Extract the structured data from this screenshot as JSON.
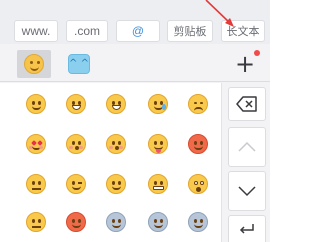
{
  "quick_input": {
    "keys": [
      "www.",
      ".com",
      "@",
      "剪贴板",
      "长文本"
    ]
  },
  "category_bar": {
    "tabs": [
      {
        "icon": "emoji-smile-icon",
        "active": true
      },
      {
        "icon": "kaomoji-face-icon",
        "active": false,
        "glyph": "^ ^"
      }
    ],
    "plus_label": "+",
    "badge_color": "#f24a4a"
  },
  "emoji_grid": {
    "rows": [
      [
        "smile",
        "grin",
        "grin",
        "tear",
        "cry"
      ],
      [
        "heart",
        "kiss",
        "kiss",
        "tongue",
        "angry"
      ],
      [
        "flat",
        "wink",
        "smile",
        "teeth",
        "shock"
      ],
      [
        "flat",
        "angry",
        "fear",
        "fear",
        "fear"
      ]
    ]
  },
  "function_keys": {
    "delete": "⌫",
    "up": "∧",
    "down": "∨",
    "return": "↩"
  },
  "colors": {
    "accent": "#3c8fe0",
    "annotation": "#e23a3a"
  }
}
